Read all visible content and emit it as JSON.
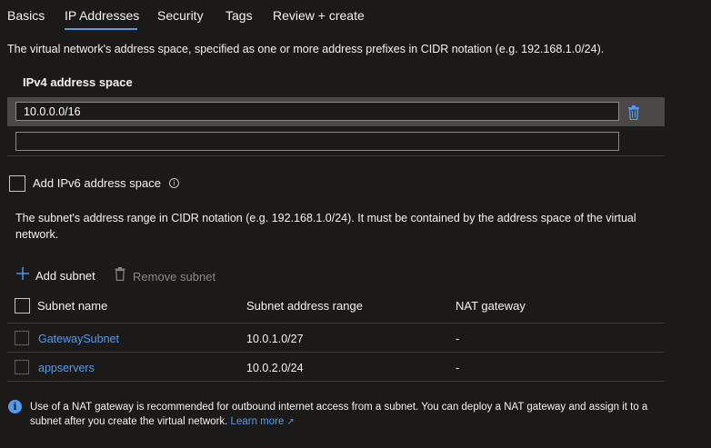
{
  "tabs": [
    {
      "label": "Basics"
    },
    {
      "label": "IP Addresses"
    },
    {
      "label": "Security"
    },
    {
      "label": "Tags"
    },
    {
      "label": "Review + create"
    }
  ],
  "active_tab": "IP Addresses",
  "description": "The virtual network's address space, specified as one or more address prefixes in CIDR notation (e.g. 192.168.1.0/24).",
  "ipv4": {
    "label": "IPv4 address space",
    "values": [
      "10.0.0.0/16",
      ""
    ]
  },
  "ipv6": {
    "label": "Add IPv6 address space",
    "checked": false
  },
  "subnet_description": "The subnet's address range in CIDR notation (e.g. 192.168.1.0/24). It must be contained by the address space of the virtual network.",
  "commands": {
    "add": "Add subnet",
    "remove": "Remove subnet"
  },
  "table": {
    "headers": [
      "Subnet name",
      "Subnet address range",
      "NAT gateway"
    ],
    "rows": [
      {
        "name": "GatewaySubnet",
        "range": "10.0.1.0/27",
        "nat": "-"
      },
      {
        "name": "appservers",
        "range": "10.0.2.0/24",
        "nat": "-"
      }
    ]
  },
  "note": {
    "text": "Use of a NAT gateway is recommended for outbound internet access from a subnet. You can deploy a NAT gateway and assign it to a subnet after you create the virtual network.",
    "link": "Learn more"
  },
  "colors": {
    "accent": "#4f9cf5",
    "background": "#1b1a19",
    "highlight_row": "#4a4948"
  }
}
